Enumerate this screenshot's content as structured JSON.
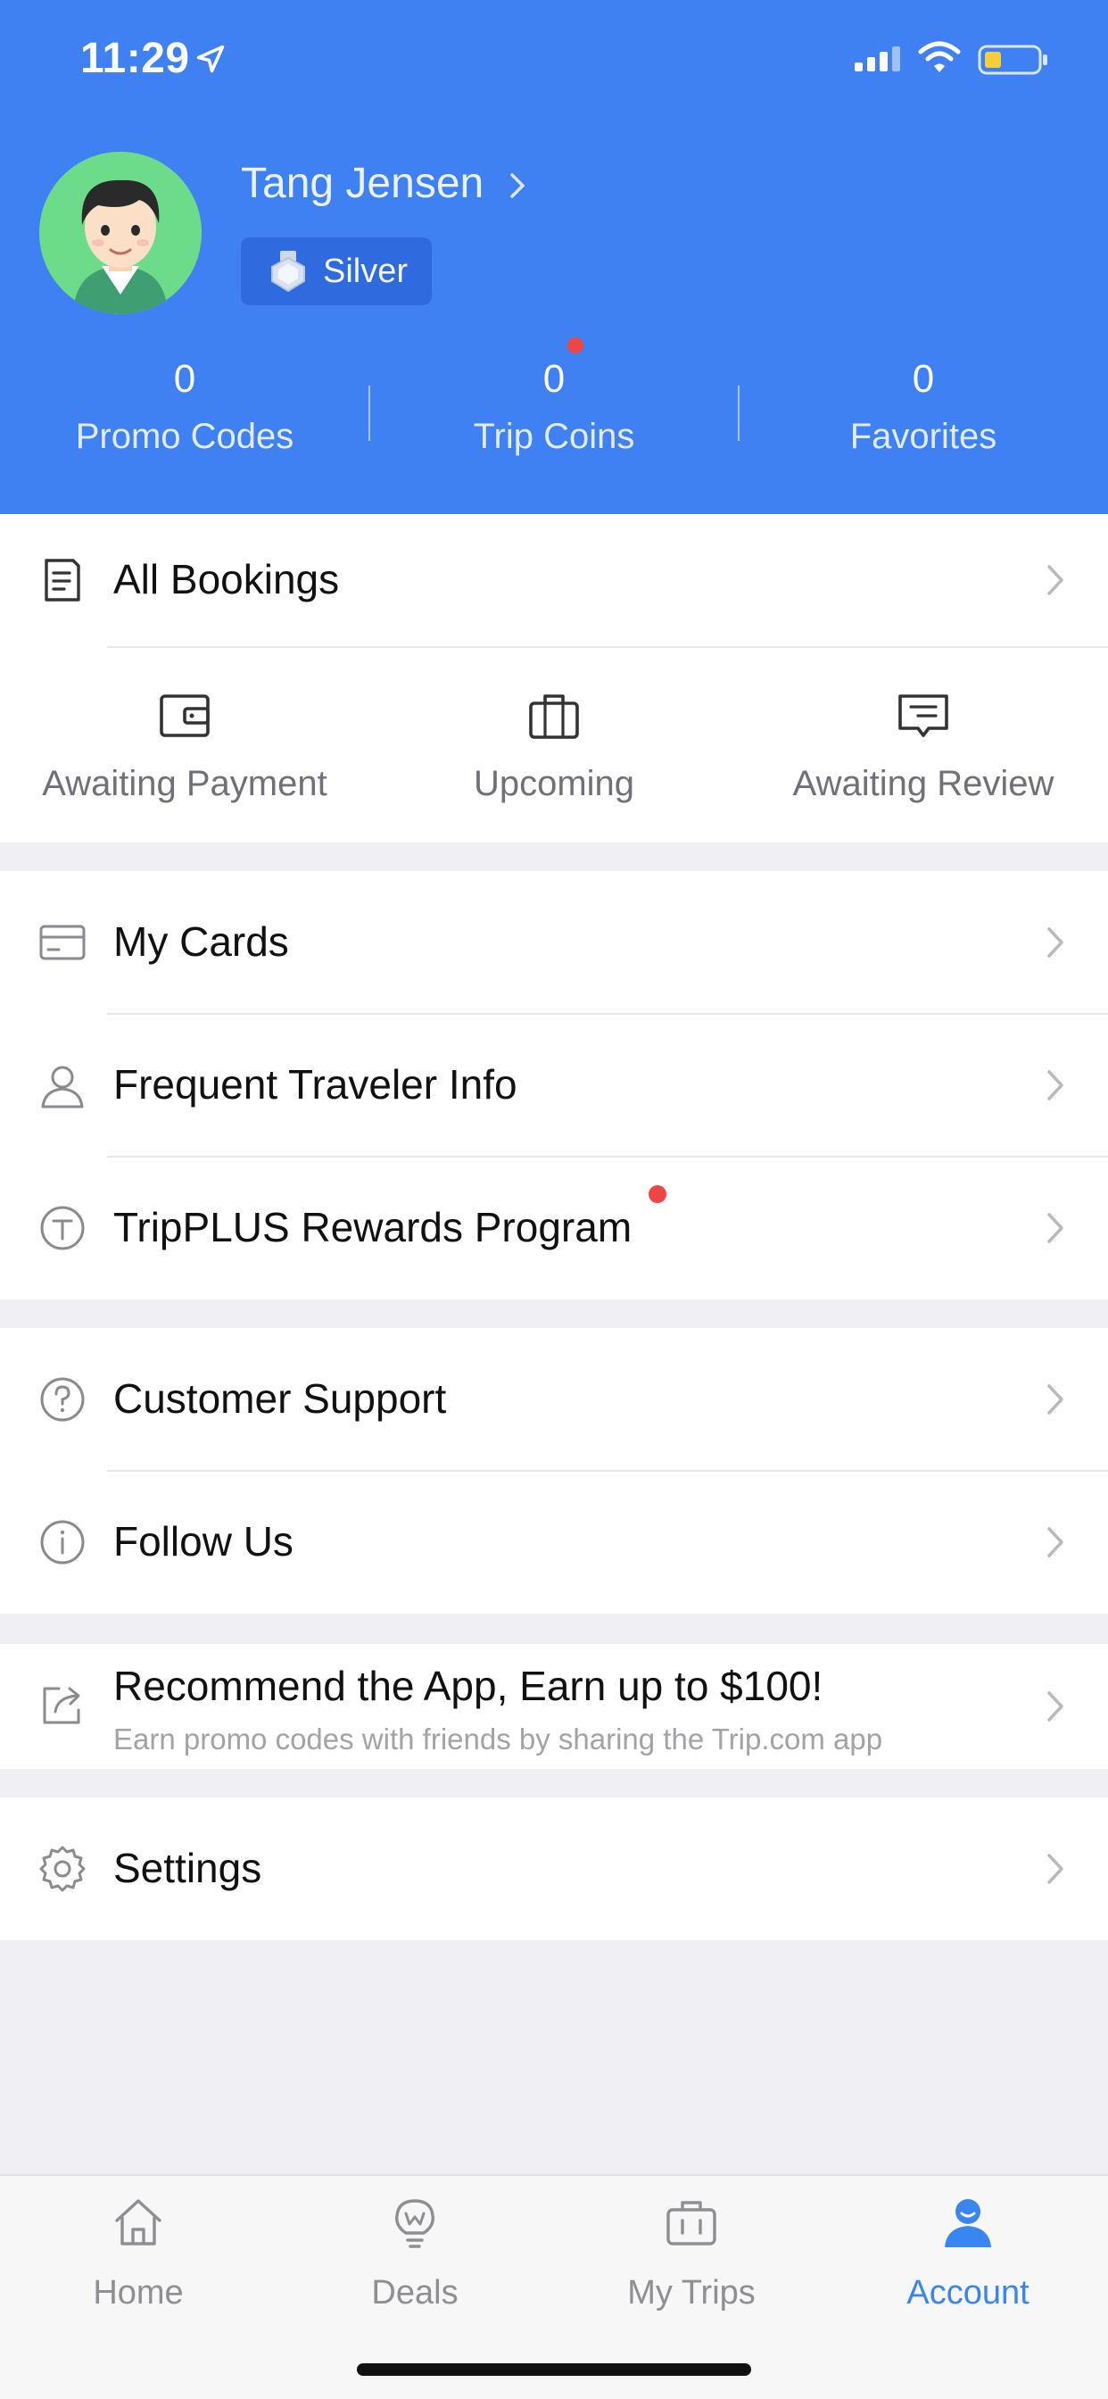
{
  "status_bar": {
    "time": "11:29"
  },
  "profile": {
    "name": "Tang Jensen",
    "level": "Silver"
  },
  "stats": [
    {
      "value": "0",
      "label": "Promo Codes"
    },
    {
      "value": "0",
      "label": "Trip Coins"
    },
    {
      "value": "0",
      "label": "Favorites"
    }
  ],
  "bookings": {
    "title": "All Bookings",
    "sub_items": [
      {
        "label": "Awaiting Payment",
        "icon": "wallet-icon"
      },
      {
        "label": "Upcoming",
        "icon": "suitcase-icon"
      },
      {
        "label": "Awaiting Review",
        "icon": "review-icon"
      }
    ]
  },
  "menu": {
    "my_cards": {
      "label": "My Cards",
      "icon": "card-icon"
    },
    "frequent_traveler": {
      "label": "Frequent Traveler Info",
      "icon": "person-icon"
    },
    "tripplus": {
      "label": "TripPLUS Rewards Program",
      "icon": "tripplus-icon"
    },
    "customer_support": {
      "label": "Customer Support",
      "icon": "question-icon"
    },
    "follow_us": {
      "label": "Follow Us",
      "icon": "info-icon"
    },
    "recommend": {
      "label": "Recommend the App, Earn up to $100!",
      "sub": "Earn promo codes with friends by sharing the Trip.com app",
      "icon": "share-icon"
    },
    "settings": {
      "label": "Settings",
      "icon": "gear-icon"
    }
  },
  "tabs": [
    {
      "label": "Home",
      "icon": "home-icon"
    },
    {
      "label": "Deals",
      "icon": "lightbulb-icon"
    },
    {
      "label": "My Trips",
      "icon": "briefcase-icon"
    },
    {
      "label": "Account",
      "icon": "account-icon",
      "active": true
    }
  ],
  "colors": {
    "header_blue": "#3f80f3",
    "active_tab": "#3a86f0",
    "notification_dot": "#f04545"
  }
}
